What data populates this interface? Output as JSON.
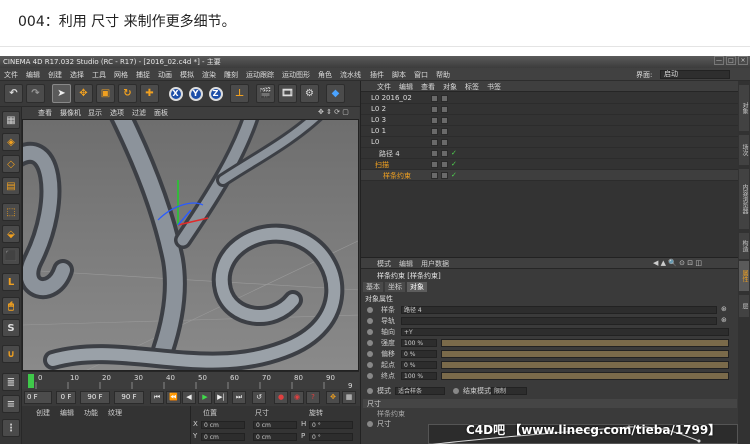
{
  "caption": "004：利用 尺寸 来制作更多细节。",
  "window": {
    "title": "CINEMA 4D R17.032 Studio (RC - R17) - [2016_02.c4d *] - 主要",
    "btn_min": "—",
    "btn_max": "□",
    "btn_close": "×"
  },
  "menu": {
    "items": [
      "文件",
      "编辑",
      "创建",
      "选择",
      "工具",
      "网格",
      "捕捉",
      "动画",
      "模拟",
      "渲染",
      "雕刻",
      "运动跟踪",
      "运动图形",
      "角色",
      "流水线",
      "插件",
      "脚本",
      "窗口",
      "帮助"
    ],
    "layout_label": "界面:",
    "layout_value": "启动"
  },
  "toolbar": {
    "axis_x": "X",
    "axis_y": "Y",
    "axis_z": "Z"
  },
  "viewport": {
    "menu": [
      "查看",
      "摄像机",
      "显示",
      "选项",
      "过滤",
      "面板"
    ]
  },
  "timeline": {
    "ticks": [
      "0",
      "10",
      "20",
      "30",
      "40",
      "50",
      "60",
      "70",
      "80",
      "90"
    ],
    "frame_end": "9",
    "frame_start": "0 F",
    "frame_field": "0 F",
    "frame_total": "90 F",
    "frame_max": "90 F"
  },
  "materials": {
    "menu": [
      "创建",
      "编辑",
      "功能",
      "纹理"
    ]
  },
  "coords": {
    "headers": [
      "位置",
      "尺寸",
      "旋转"
    ],
    "rows": [
      {
        "axis": "X",
        "pos": "0 cm",
        "size": "0 cm",
        "rot": "H",
        "rot_val": "0 °"
      },
      {
        "axis": "Y",
        "pos": "0 cm",
        "size": "0 cm",
        "rot": "P",
        "rot_val": "0 °"
      }
    ]
  },
  "objects": {
    "menu": [
      "文件",
      "编辑",
      "查看",
      "对象",
      "标签",
      "书签"
    ],
    "rows": [
      {
        "name": "L0 2016_02"
      },
      {
        "name": "L0 2"
      },
      {
        "name": "L0 3"
      },
      {
        "name": "L0 1"
      },
      {
        "name": "L0"
      },
      {
        "name": "路径 4"
      },
      {
        "name": "扫描"
      },
      {
        "name": "样条约束"
      }
    ]
  },
  "attributes": {
    "menu": [
      "模式",
      "编辑",
      "用户数据"
    ],
    "title": "样条约束 [样条约束]",
    "tabs": [
      "基本",
      "坐标",
      "对象"
    ],
    "section": "对象属性",
    "path_label": "样条",
    "path_value": "路径 4",
    "guide_label": "导轨",
    "axis_label": "轴向",
    "axis_value": "+Y",
    "strength_label": "强度",
    "strength_value": "100 %",
    "offset_label": "偏移",
    "offset_value": "0 %",
    "start_label": "起点",
    "start_value": "0 %",
    "end_label": "终点",
    "end_value": "100 %",
    "mode_label": "模式",
    "mode_value": "适合样条",
    "end_mode_label": "结束模式",
    "end_mode_value": "限制",
    "size_section": "尺寸",
    "size_sub": "样条约束",
    "size_label": "尺寸"
  },
  "right_tabs": [
    "对象",
    "场次",
    "内容浏览器",
    "构造",
    "属性",
    "层"
  ],
  "watermark": "C4D吧  【www.linecg.com/tieba/1799】"
}
